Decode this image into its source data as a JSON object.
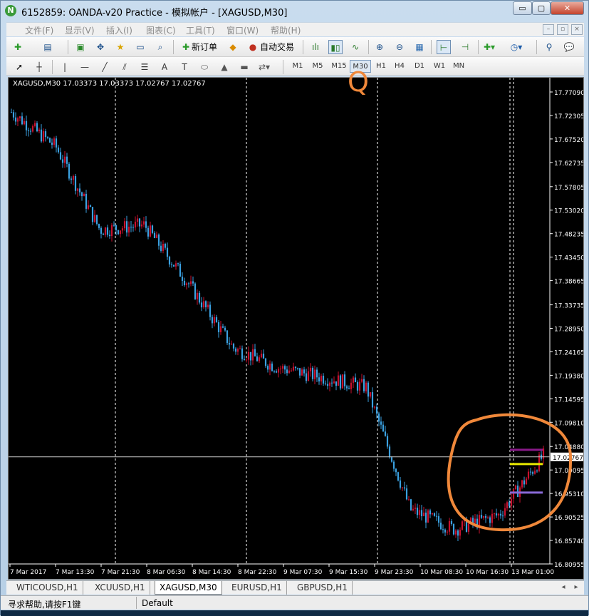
{
  "window": {
    "title": "6152859: OANDA-v20 Practice - 模拟帐户 - [XAGUSD,M30]",
    "logo": "N",
    "controls": {
      "minimize": "▭",
      "maximize": "▢",
      "close": "✕"
    }
  },
  "menubar": {
    "items": [
      "文件(F)",
      "显示(V)",
      "插入(I)",
      "图表(C)",
      "工具(T)",
      "窗口(W)",
      "帮助(H)"
    ],
    "mdi_controls": [
      "–",
      "▫",
      "×"
    ]
  },
  "toolbar1": {
    "new_order_label": "新订单",
    "auto_trade_label": "自动交易"
  },
  "toolbar2": {
    "timeframes": [
      "M1",
      "M5",
      "M15",
      "M30",
      "H1",
      "H4",
      "D1",
      "W1",
      "MN"
    ],
    "selected_timeframe": "M30"
  },
  "annotations": {
    "note_mark": "Q",
    "color": "#f0883a"
  },
  "chart": {
    "info_line": "XAGUSD,M30  17.03373 17.03373 17.02767 17.02767",
    "current_price": "17.02767",
    "price_ticks": [
      "17.77090",
      "17.72305",
      "17.67520",
      "17.62735",
      "17.57805",
      "17.53020",
      "17.48235",
      "17.43450",
      "17.38665",
      "17.33735",
      "17.28950",
      "17.24165",
      "17.19380",
      "17.14595",
      "17.09810",
      "17.04880",
      "17.00095",
      "16.95310",
      "16.90525",
      "16.85740",
      "16.80955"
    ],
    "time_ticks": [
      "7 Mar 2017",
      "7 Mar 13:30",
      "7 Mar 21:30",
      "8 Mar 06:30",
      "8 Mar 14:30",
      "8 Mar 22:30",
      "9 Mar 07:30",
      "9 Mar 15:30",
      "9 Mar 23:30",
      "10 Mar 08:30",
      "10 Mar 16:30",
      "13 Mar 01:00"
    ],
    "colors": {
      "background": "#000000",
      "bull": "#c8102e",
      "bear": "#3aa0e0",
      "grid": "#ffffff",
      "text": "#ffffff"
    }
  },
  "chart_data": {
    "type": "candlestick",
    "symbol": "XAGUSD",
    "timeframe": "M30",
    "ylim": [
      16.80955,
      17.7709
    ],
    "x": [
      "7 Mar 2017",
      "7 Mar 13:30",
      "7 Mar 21:30",
      "8 Mar 06:30",
      "8 Mar 14:30",
      "8 Mar 22:30",
      "9 Mar 07:30",
      "9 Mar 15:30",
      "9 Mar 23:30",
      "10 Mar 08:30",
      "10 Mar 16:30",
      "13 Mar 01:00"
    ],
    "close": [
      17.73,
      17.66,
      17.49,
      17.5,
      17.38,
      17.25,
      17.21,
      17.19,
      17.17,
      16.92,
      16.88,
      16.91,
      17.03
    ],
    "open": 17.73,
    "last": {
      "open": 17.03373,
      "high": 17.03373,
      "low": 17.02767,
      "close": 17.02767
    },
    "levels": [
      {
        "price": 17.042,
        "color": "#8a1a8a"
      },
      {
        "price": 17.013,
        "color": "#e8e800"
      },
      {
        "price": 16.955,
        "color": "#8a6ad8"
      }
    ]
  },
  "tabs": [
    "WTICOUSD,H1",
    "XCUUSD,H1",
    "XAGUSD,M30",
    "EURUSD,H1",
    "GBPUSD,H1"
  ],
  "active_tab": "XAGUSD,M30",
  "status": {
    "help": "寻求帮助,请按F1键",
    "profile": "Default"
  }
}
